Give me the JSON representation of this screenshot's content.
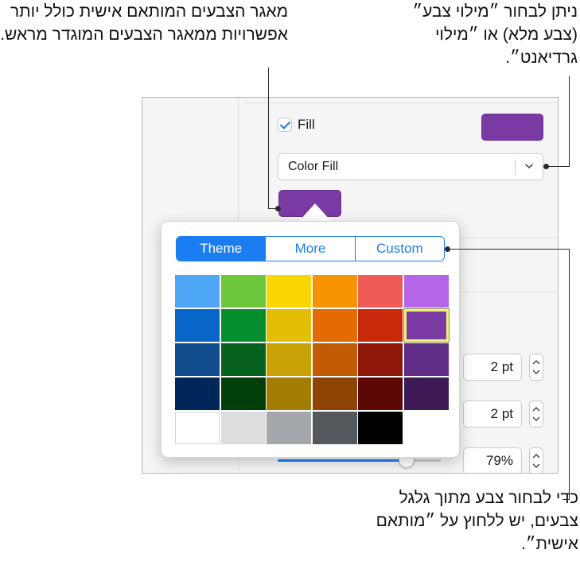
{
  "callouts": {
    "top_left": "מאגר הצבעים המותאם אישית כולל יותר אפשרויות ממאגר הצבעים המוגדר מראש.",
    "top_right": "ניתן לבחור ״מילוי צבע״ (צבע מלא) או ״מילוי גרדיאנט״.",
    "bottom": "כדי לבחור צבע מתוך גלגל צבעים, יש ללחוץ על ״מותאם אישית״."
  },
  "fill": {
    "checkbox_label": "Fill",
    "checked": true,
    "color": "#7a3aa3",
    "type_selected": "Color Fill"
  },
  "popover": {
    "tabs": [
      {
        "label": "Theme",
        "active": true
      },
      {
        "label": "More",
        "active": false
      },
      {
        "label": "Custom",
        "active": false
      }
    ],
    "swatches": [
      [
        "#4ea6f7",
        "#6dc63b",
        "#fad600",
        "#f59300",
        "#ef5b57",
        "#b566e6"
      ],
      [
        "#0a65c8",
        "#058e2d",
        "#e2bf04",
        "#e46b04",
        "#c9290b",
        "#7a3aa3"
      ],
      [
        "#124e8e",
        "#05611d",
        "#c7a204",
        "#c25b05",
        "#8f1709",
        "#5f2c86"
      ],
      [
        "#012659",
        "#033f0b",
        "#a37c03",
        "#8e4405",
        "#5c0905",
        "#3f1b56"
      ],
      [
        "#ffffff",
        "#dcdddf",
        "#a4a7a9",
        "#54575c",
        "#000000"
      ]
    ],
    "selected": {
      "row": 1,
      "col": 5
    }
  },
  "fields": [
    {
      "value": "2 pt"
    },
    {
      "value": "2 pt"
    },
    {
      "value": "79%"
    }
  ],
  "slider": {
    "value_fraction": 0.79
  },
  "colors": {
    "accent": "#1a7ef2",
    "fill": "#7a3aa3"
  }
}
